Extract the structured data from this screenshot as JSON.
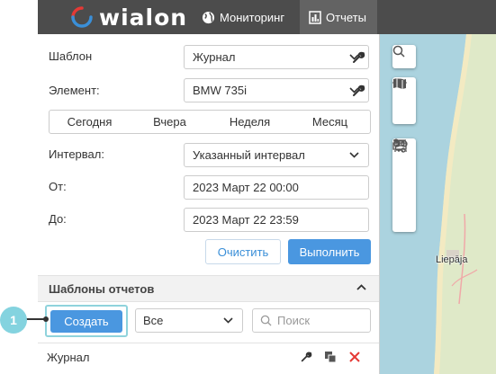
{
  "app": {
    "logo_text": "wialon",
    "accent_color": "#4a97e0",
    "callout_color": "#84d3df",
    "logo_red": "#e53935",
    "logo_blue": "#3a8fd8"
  },
  "topbar": {
    "items": [
      {
        "label": "Мониторинг",
        "icon": "globe-icon",
        "active": false
      },
      {
        "label": "Отчеты",
        "icon": "report-icon",
        "active": true
      }
    ]
  },
  "form": {
    "template_label": "Шаблон",
    "template_value": "Журнал",
    "element_label": "Элемент:",
    "element_value": "BMW 735i",
    "periods": [
      "Сегодня",
      "Вчера",
      "Неделя",
      "Месяц"
    ],
    "interval_label": "Интервал:",
    "interval_value": "Указанный интервал",
    "from_label": "От:",
    "from_value": "2023 Март 22 00:00",
    "to_label": "До:",
    "to_value": "2023 Март 22 23:59",
    "clear_label": "Очистить",
    "run_label": "Выполнить"
  },
  "templates": {
    "section_title": "Шаблоны отчетов",
    "create_label": "Создать",
    "filter_value": "Все",
    "search_placeholder": "Поиск",
    "items": [
      {
        "name": "Журнал"
      }
    ]
  },
  "callout": {
    "number": "1"
  },
  "map": {
    "city_label": "Liepāja",
    "tools": [
      "search-icon",
      "eye-icon",
      "map-icon",
      "ruler-icon",
      "route-icon",
      "geofence-icon",
      "chevron-right-icon"
    ]
  }
}
